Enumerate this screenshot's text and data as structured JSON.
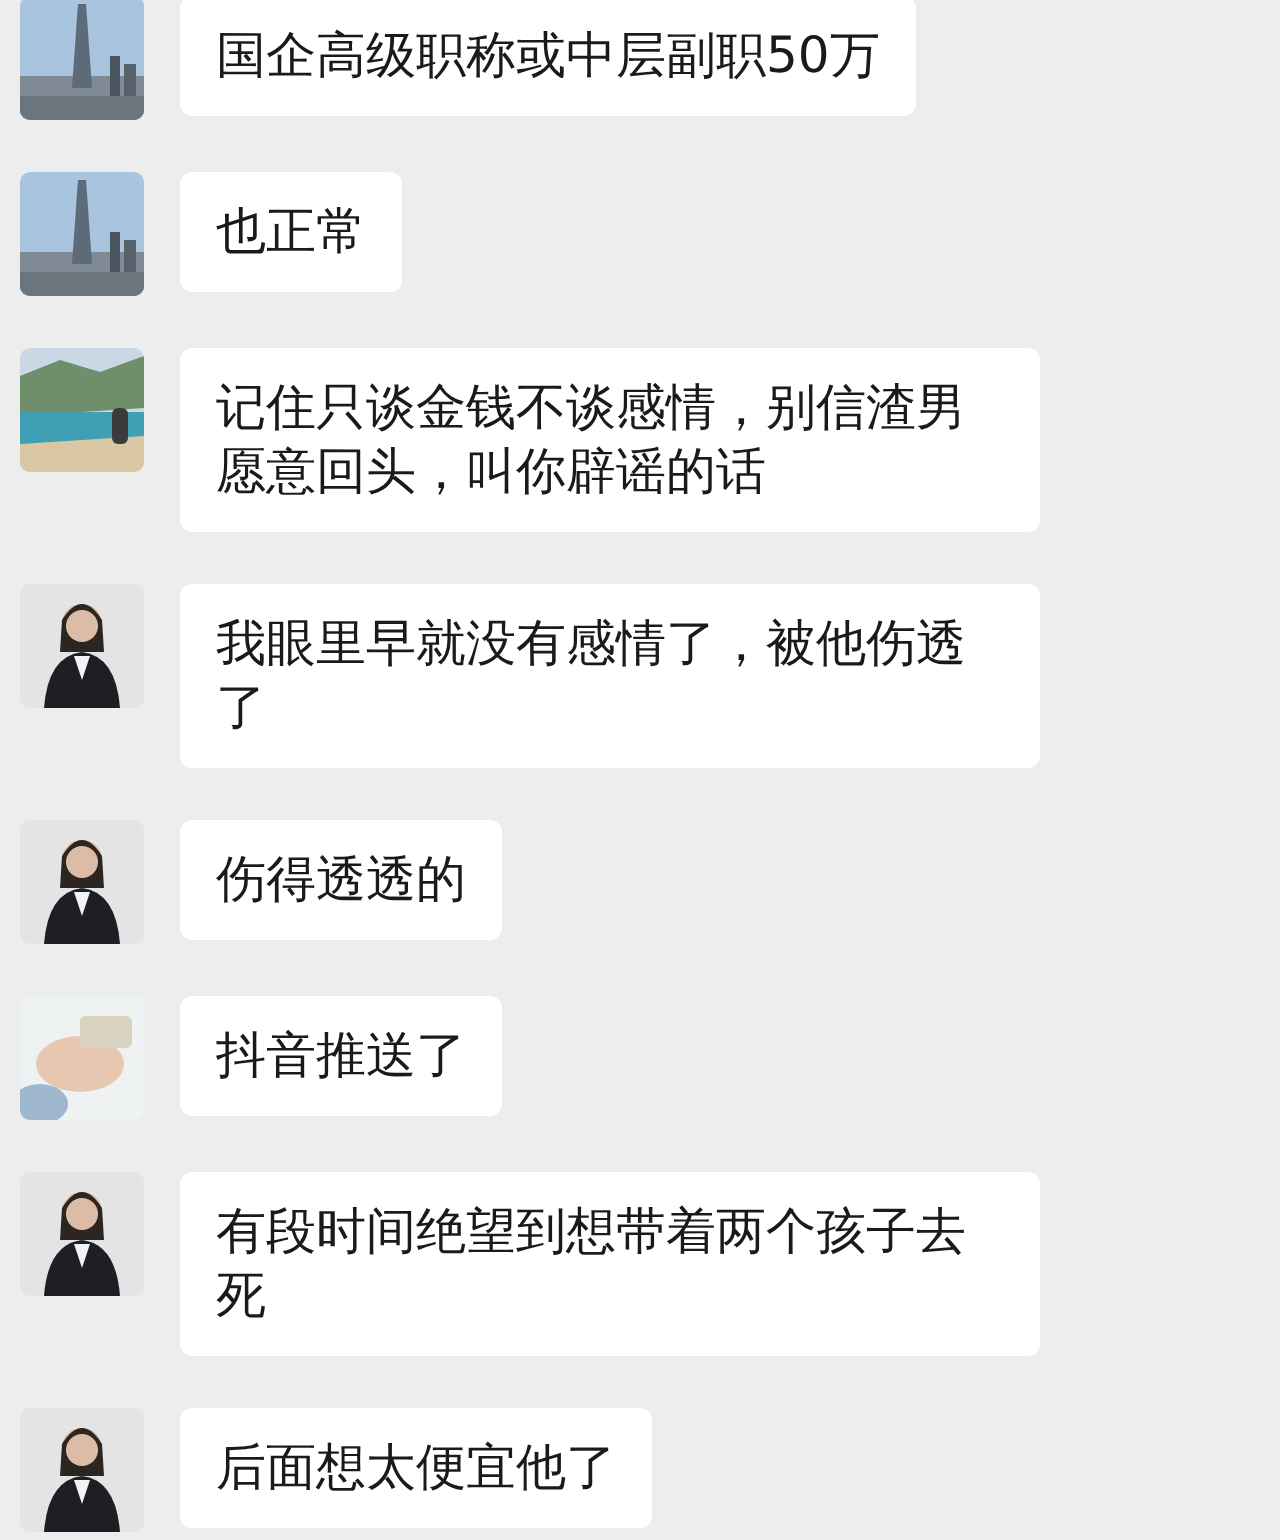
{
  "messages": [
    {
      "text": "国企高级职称或中层副职50万"
    },
    {
      "text": "也正常"
    },
    {
      "text": "记住只谈金钱不谈感情，别信渣男愿意回头，叫你辟谣的话"
    },
    {
      "text": "我眼里早就没有感情了，被他伤透了"
    },
    {
      "text": "伤得透透的"
    },
    {
      "text": "抖音推送了"
    },
    {
      "text": "有段时间绝望到想带着两个孩子去死"
    },
    {
      "text": "后面想太便宜他了"
    }
  ]
}
